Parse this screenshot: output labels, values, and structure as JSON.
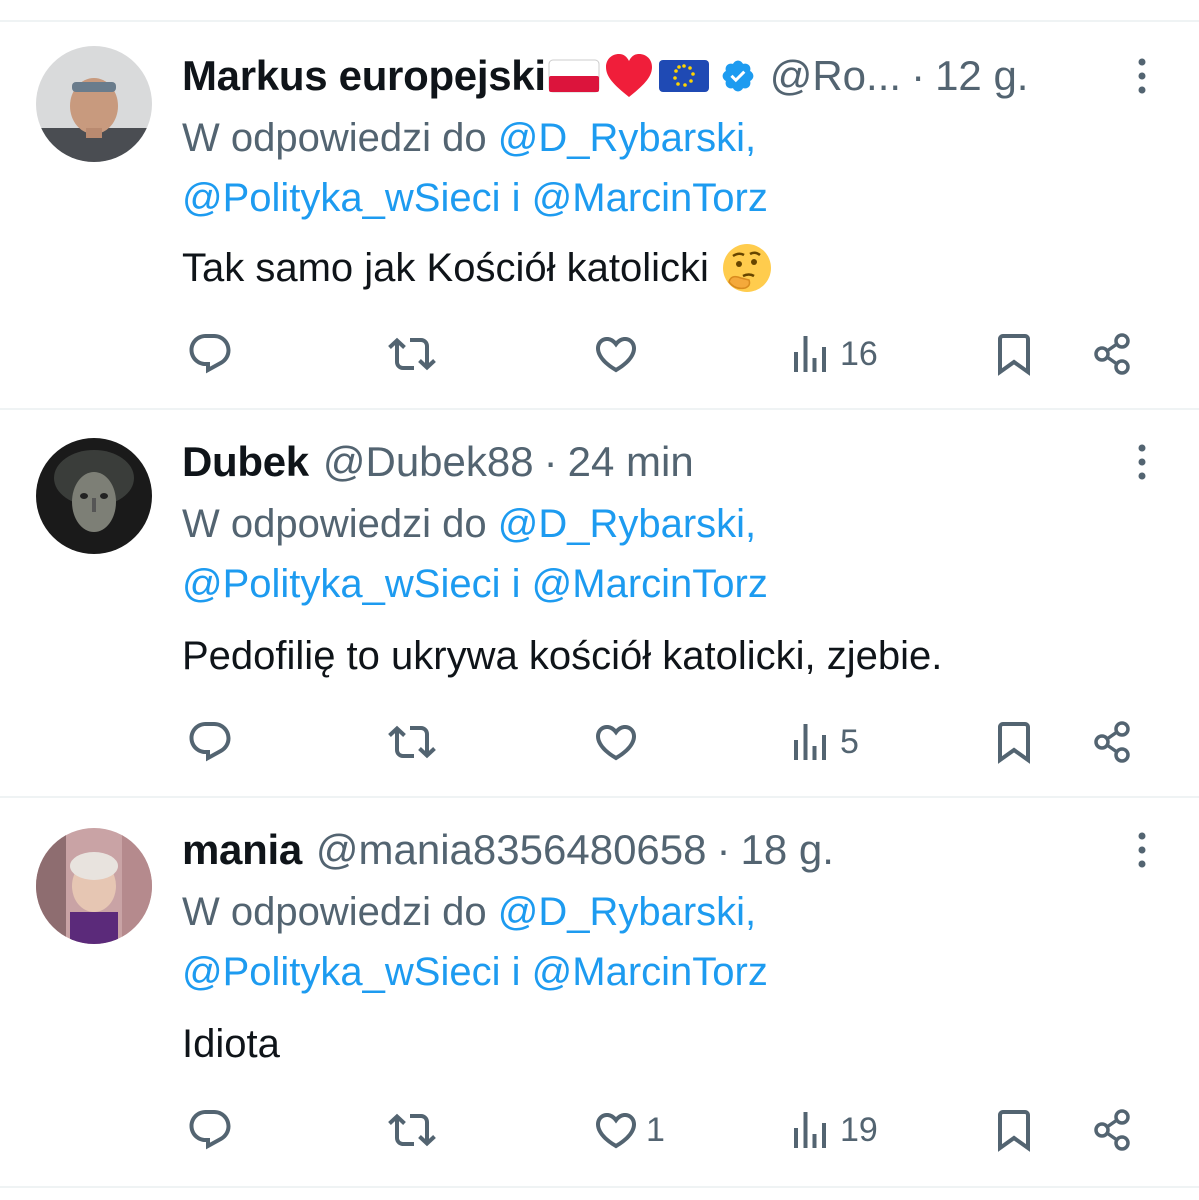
{
  "replies_label": {
    "prefix": "W odpowiedzi do",
    "to1": "@D_Rybarski,",
    "to2": "@Polityka_wSieci",
    "joiner": "i",
    "to3": "@MarcinTorz"
  },
  "tweets": [
    {
      "name": "Markus europejski",
      "handle": "@Ro...",
      "separator": "·",
      "time": "12 g.",
      "verified": true,
      "text": "Tak samo jak Kościół katolicki",
      "emoji": "thinking-face",
      "stats": {
        "replies": "",
        "retweets": "",
        "likes": "",
        "views": "16"
      }
    },
    {
      "name": "Dubek",
      "handle": "@Dubek88",
      "separator": "·",
      "time": "24 min",
      "verified": false,
      "text": "Pedofilię to ukrywa kościół katolicki, zjebie.",
      "stats": {
        "replies": "",
        "retweets": "",
        "likes": "",
        "views": "5"
      }
    },
    {
      "name": "mania",
      "handle": "@mania8356480658",
      "separator": "·",
      "time": "18 g.",
      "verified": false,
      "text": "Idiota",
      "stats": {
        "replies": "",
        "retweets": "",
        "likes": "1",
        "views": "19"
      }
    }
  ],
  "colors": {
    "text": "#0f1419",
    "secondary": "#536471",
    "link": "#1d9bf0",
    "verified": "#1d9bf0",
    "divider": "#eff3f4"
  },
  "icons": [
    "reply-icon",
    "retweet-icon",
    "like-icon",
    "views-icon",
    "bookmark-icon",
    "share-icon",
    "more-icon",
    "verified-badge-icon"
  ]
}
